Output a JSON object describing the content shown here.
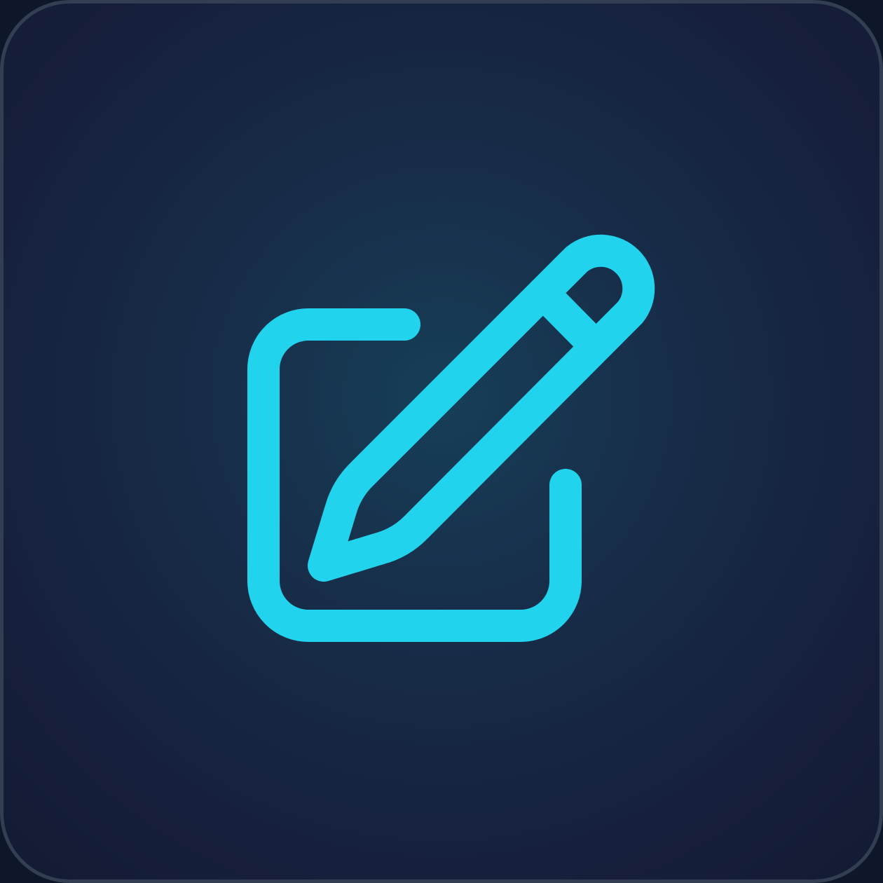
{
  "icon": {
    "name": "edit-icon",
    "stroke_color": "#22d3ee",
    "tile_border_color": "#343e53",
    "tile_background": "#172d49"
  }
}
